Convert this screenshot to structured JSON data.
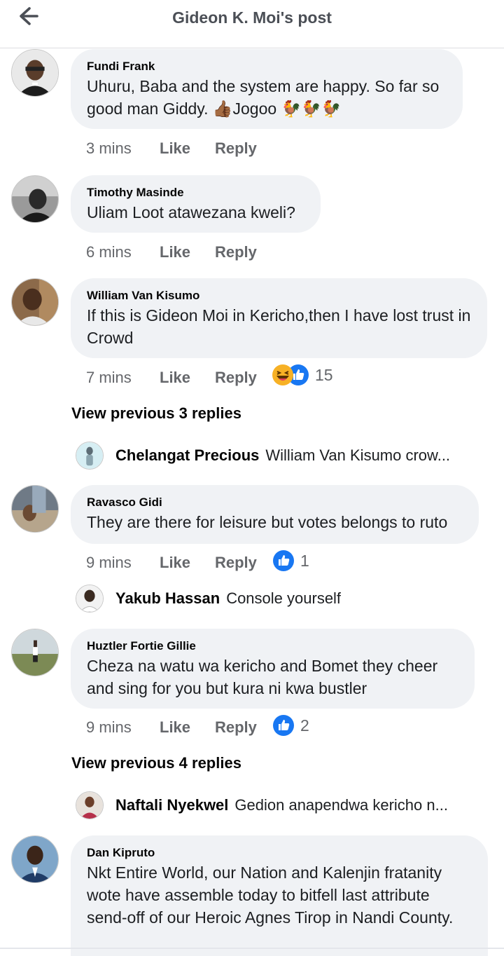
{
  "header": {
    "title": "Gideon K. Moi's post"
  },
  "colors": {
    "bubble": "#f0f2f5",
    "meta": "#65676b",
    "like_blue": "#1877f2",
    "haha_yellow": "#f7b125"
  },
  "comments": [
    {
      "name": "Fundi Frank",
      "text": "Uhuru, Baba and the system are happy. So far so good man Giddy. 👍🏾Jogoo 🐓🐓🐓",
      "time": "3 mins",
      "like": "Like",
      "reply": "Reply"
    },
    {
      "name": "Timothy Masinde",
      "text": "Uliam Loot atawezana kweli?",
      "time": "6 mins",
      "like": "Like",
      "reply": "Reply"
    },
    {
      "name": "William Van Kisumo",
      "text": "If this is Gideon Moi in Kericho,then I have lost trust in Crowd",
      "time": "7 mins",
      "like": "Like",
      "reply": "Reply",
      "reaction_count": "15",
      "reactions": [
        "haha-icon",
        "like-icon"
      ]
    },
    {
      "name": "Ravasco Gidi",
      "text": "They are there for leisure but votes belongs to ruto",
      "time": "9 mins",
      "like": "Like",
      "reply": "Reply",
      "reaction_count": "1",
      "reactions": [
        "like-icon"
      ]
    },
    {
      "name": "Huztler Fortie Gillie",
      "text": "Cheza na watu wa kericho  and Bomet  they cheer and  sing for you but kura ni kwa bustler",
      "time": "9 mins",
      "like": "Like",
      "reply": "Reply",
      "reaction_count": "2",
      "reactions": [
        "like-icon"
      ]
    },
    {
      "name": "Dan Kipruto",
      "text": "Nkt Entire World, our Nation and Kalenjin fratanity wote have assemble today to bitfell last attribute send-off of our Heroic Agnes Tirop in Nandi County."
    }
  ],
  "view_previous": [
    "View previous 3 replies",
    "View previous 4 replies"
  ],
  "replies": [
    {
      "name": "Chelangat Precious",
      "text": "William Van Kisumo crow..."
    },
    {
      "name": "Yakub Hassan",
      "text": "Console yourself"
    },
    {
      "name": "Naftali Nyekwel",
      "text": "Gedion anapendwa kericho n..."
    }
  ]
}
